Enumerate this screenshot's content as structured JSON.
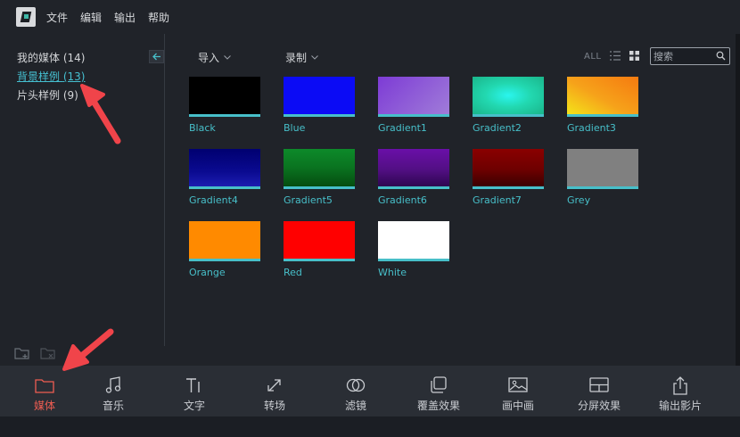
{
  "menubar": {
    "items": [
      "文件",
      "编辑",
      "输出",
      "帮助"
    ]
  },
  "library": {
    "items": [
      {
        "label": "我的媒体",
        "count": "(14)"
      },
      {
        "label": "背景样例",
        "count": "(13)"
      },
      {
        "label": "片头样例",
        "count": "(9)"
      }
    ],
    "active_index": 1
  },
  "main": {
    "import_label": "导入",
    "record_label": "录制",
    "view_all_label": "ALL",
    "search_placeholder": "搜索",
    "tiles": [
      {
        "label": "Black",
        "color": "#000000"
      },
      {
        "label": "Blue",
        "color": "#0b0bf5"
      },
      {
        "label": "Gradient1",
        "color": "#8c55d6"
      },
      {
        "label": "Gradient2",
        "color": "#22e6c8"
      },
      {
        "label": "Gradient3",
        "color": "#f6a21a"
      },
      {
        "label": "Gradient4",
        "color": "#0a0a80"
      },
      {
        "label": "Gradient5",
        "color": "#0b7a1e"
      },
      {
        "label": "Gradient6",
        "color": "#52137e"
      },
      {
        "label": "Gradient7",
        "color": "#7d0000"
      },
      {
        "label": "Grey",
        "color": "#808080"
      },
      {
        "label": "Orange",
        "color": "#ff8a00"
      },
      {
        "label": "Red",
        "color": "#ff0000"
      },
      {
        "label": "White",
        "color": "#ffffff"
      }
    ]
  },
  "toolbar": {
    "tools": [
      {
        "label": "媒体",
        "icon": "folder-icon",
        "active": true
      },
      {
        "label": "音乐",
        "icon": "music-note-icon",
        "active": false
      },
      {
        "label": "文字",
        "icon": "text-icon",
        "active": false
      },
      {
        "label": "转场",
        "icon": "transition-icon",
        "active": false
      },
      {
        "label": "滤镜",
        "icon": "filter-icon",
        "active": false
      },
      {
        "label": "覆盖效果",
        "icon": "overlay-icon",
        "active": false
      },
      {
        "label": "画中画",
        "icon": "picture-in-picture-icon",
        "active": false
      },
      {
        "label": "分屏效果",
        "icon": "split-screen-icon",
        "active": false
      },
      {
        "label": "输出影片",
        "icon": "export-icon",
        "active": false
      }
    ]
  },
  "colors": {
    "accent_teal": "#47bfc9",
    "active_red": "#ef5d52",
    "annotation_arrow": "#f0444a"
  }
}
